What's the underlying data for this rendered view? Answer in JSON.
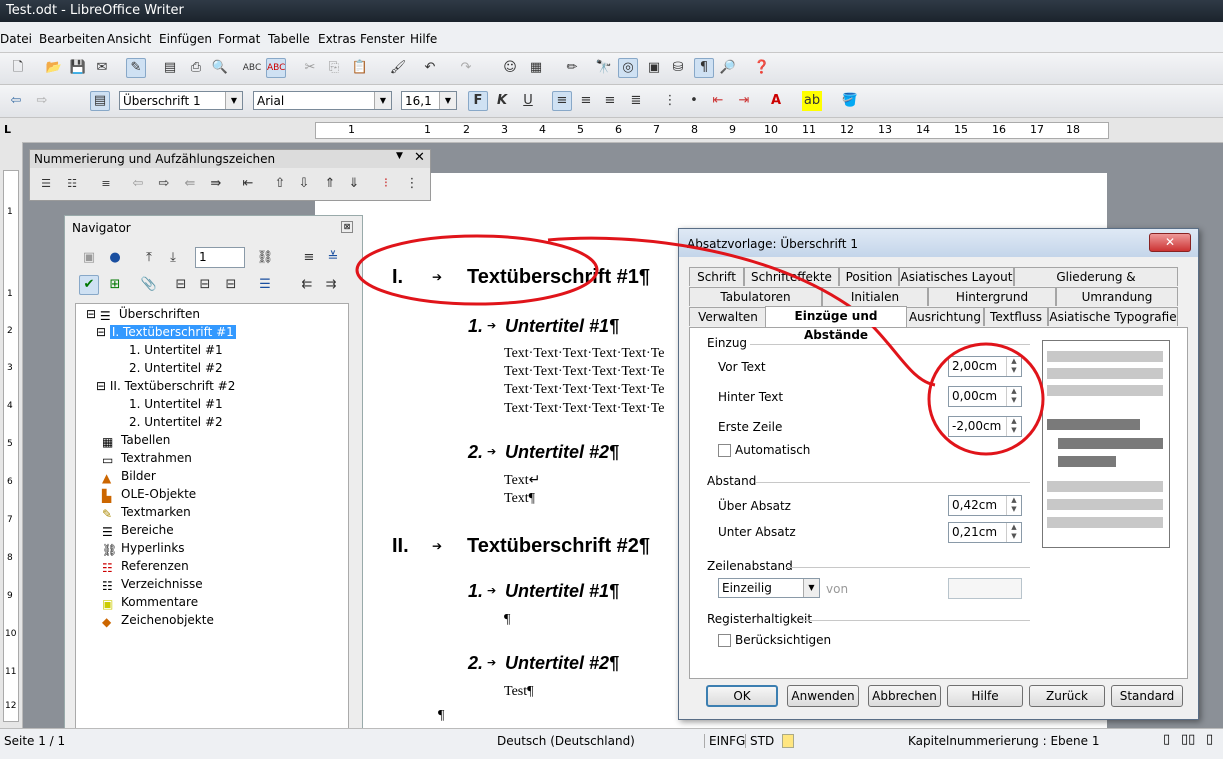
{
  "window_title": "Test.odt - LibreOffice Writer",
  "menu": [
    "Datei",
    "Bearbeiten",
    "Ansicht",
    "Einfügen",
    "Format",
    "Tabelle",
    "Extras",
    "Fenster",
    "Hilfe"
  ],
  "format_bar": {
    "style": "Überschrift 1",
    "font": "Arial",
    "size": "16,1"
  },
  "ruler_numbers": [
    "1",
    "1",
    "2",
    "3",
    "4",
    "5",
    "6",
    "7",
    "8",
    "9",
    "10",
    "11",
    "12",
    "13",
    "14",
    "15",
    "16",
    "17",
    "18"
  ],
  "left_ruler_numbers": [
    "1",
    "1",
    "2",
    "3",
    "4",
    "5",
    "6",
    "7",
    "8",
    "9",
    "10",
    "11",
    "12"
  ],
  "document": {
    "h1": [
      {
        "num": "I.",
        "text": "Textüberschrift #1¶"
      },
      {
        "num": "II.",
        "text": "Textüberschrift #2¶"
      }
    ],
    "h2": [
      {
        "num": "1.",
        "text": "Untertitel #1¶"
      },
      {
        "num": "2.",
        "text": "Untertitel #2¶"
      },
      {
        "num": "1.",
        "text": "Untertitel #1¶"
      },
      {
        "num": "2.",
        "text": "Untertitel #2¶"
      }
    ],
    "body_lines": [
      "Text·Text·Text·Text·Text·Te",
      "Text·Text·Text·Text·Text·Te",
      "Text·Text·Text·Text·Text·Te",
      "Text·Text·Text·Text·Text·Te"
    ],
    "text_a": "Text↵",
    "text_b": "Text¶",
    "pilcrow": "¶",
    "test": "Test¶"
  },
  "numbering_toolbar": {
    "title": "Nummerierung und Aufzählungszeichen"
  },
  "navigator": {
    "title": "Navigator",
    "page_field": "1",
    "items": [
      "Überschriften",
      "I. Textüberschrift #1",
      "1. Untertitel #1",
      "2. Untertitel #2",
      "II. Textüberschrift #2",
      "1. Untertitel #1",
      "2. Untertitel #2",
      "Tabellen",
      "Textrahmen",
      "Bilder",
      "OLE-Objekte",
      "Textmarken",
      "Bereiche",
      "Hyperlinks",
      "Referenzen",
      "Verzeichnisse",
      "Kommentare",
      "Zeichenobjekte"
    ]
  },
  "dialog": {
    "title": "Absatzvorlage: Überschrift 1",
    "tabs_row1": [
      "Schrift",
      "Schrifteffekte",
      "Position",
      "Asiatisches Layout",
      "Gliederung & Nummerierung"
    ],
    "tabs_row2": [
      "Tabulatoren",
      "Initialen",
      "Hintergrund",
      "Umrandung"
    ],
    "tabs_row3": [
      "Verwalten",
      "Einzüge und Abstände",
      "Ausrichtung",
      "Textfluss",
      "Asiatische Typografie"
    ],
    "einzug": {
      "section": "Einzug",
      "vor_label": "Vor Text",
      "vor_value": "2,00cm",
      "hinter_label": "Hinter Text",
      "hinter_value": "0,00cm",
      "erste_label": "Erste Zeile",
      "erste_value": "-2,00cm",
      "auto_label": "Automatisch"
    },
    "abstand": {
      "section": "Abstand",
      "ueber_label": "Über Absatz",
      "ueber_value": "0,42cm",
      "unter_label": "Unter Absatz",
      "unter_value": "0,21cm"
    },
    "zeilen": {
      "section": "Zeilenabstand",
      "select": "Einzeilig",
      "von": "von"
    },
    "register": {
      "section": "Registerhaltigkeit",
      "check_label": "Berücksichtigen"
    },
    "buttons": [
      "OK",
      "Anwenden",
      "Abbrechen",
      "Hilfe",
      "Zurück",
      "Standard"
    ]
  },
  "status": {
    "page": "Seite 1 / 1",
    "language": "Deutsch (Deutschland)",
    "mode": "EINFG",
    "sel": "STD",
    "outline": "Kapitelnummerierung : Ebene 1"
  },
  "colors": {
    "annotation": "#e0141a",
    "nav_selected": "#3399ff"
  }
}
